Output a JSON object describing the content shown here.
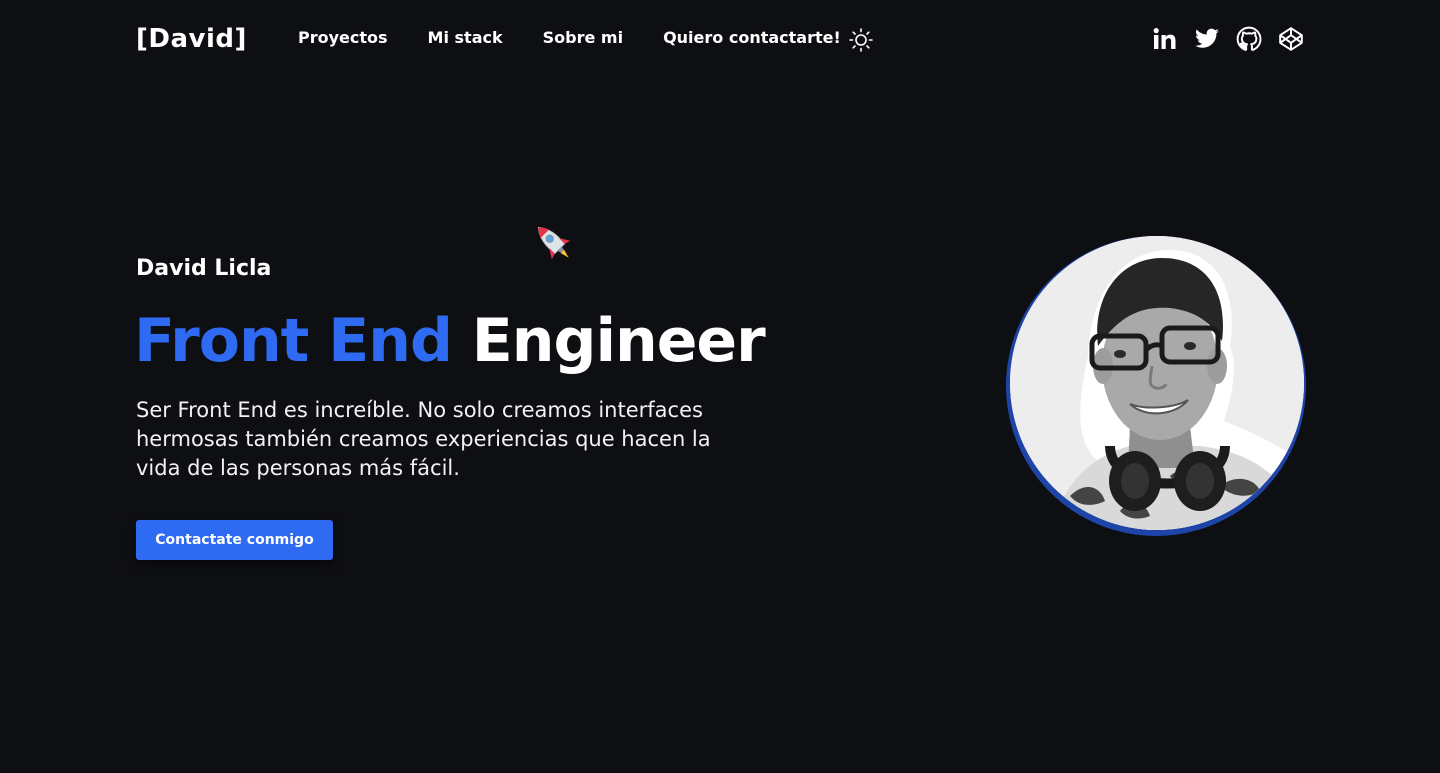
{
  "header": {
    "logo": "[David]",
    "nav": [
      "Proyectos",
      "Mi stack",
      "Sobre mi",
      "Quiero contactarte!"
    ],
    "theme_icon": "sun-icon",
    "socials": [
      "linkedin-icon",
      "twitter-icon",
      "github-icon",
      "codepen-icon"
    ]
  },
  "hero": {
    "name": "David Licla",
    "headline_accent": "Front End",
    "headline_rest": "Engineer",
    "description": "Ser Front End es increíble. No solo creamos interfaces hermosas también creamos experiencias que hacen la vida de las personas más fácil.",
    "cta_label": "Contactate conmigo",
    "decoration_icon": "rocket-icon"
  },
  "colors": {
    "background": "#0e0f13",
    "accent": "#2f6bf2",
    "text": "#ffffff",
    "avatar_ring": "#1d44a6"
  }
}
